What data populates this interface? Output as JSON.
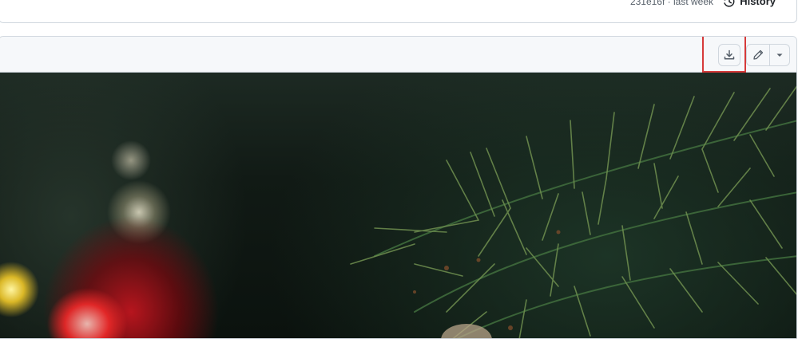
{
  "commit": {
    "meta": "231e16f · last week",
    "history_label": "History"
  },
  "file_header": {
    "download_icon": "download-icon",
    "edit_icon": "pencil-icon",
    "more_icon": "triangle-down-icon"
  },
  "colors": {
    "border": "#d0d7de",
    "header_bg": "#f6f8fa",
    "highlight": "#d63a3a"
  }
}
